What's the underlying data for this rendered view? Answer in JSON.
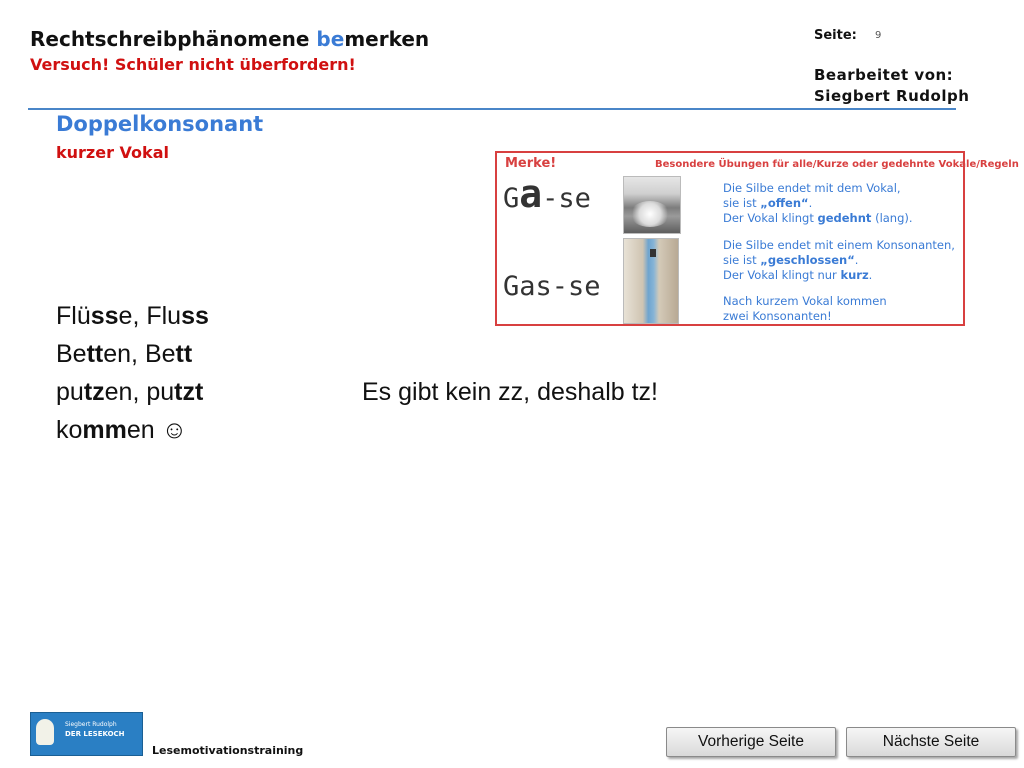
{
  "header": {
    "title_part1": "Rechtschreibphänomene ",
    "title_highlight": "be",
    "title_part2": "merken",
    "subtitle": "Versuch! Schüler nicht überfordern!",
    "page_label": "Seite:",
    "page_number": "9",
    "edited_by_label": "Bearbeitet von:",
    "edited_by_name": "Siegbert Rudolph"
  },
  "section": {
    "title": "Doppelkonsonant",
    "subtitle": "kurzer Vokal"
  },
  "merke": {
    "title": "Merke!",
    "heading": "Besondere Übungen für alle/Kurze oder gedehnte Vokale/Regeln",
    "word1_prefix": "G",
    "word1_vowel": "a",
    "word1_suffix": "-se",
    "word2": "Gas-se",
    "info1_line1": "Die Silbe endet mit dem Vokal,",
    "info1_line2_pre": "sie ist ",
    "info1_line2_bold": "„offen“",
    "info1_line2_post": ".",
    "info1_line3_pre": "Der Vokal klingt ",
    "info1_line3_bold": "gedehnt",
    "info1_line3_post": " (lang).",
    "info2_line1": "Die Silbe endet mit einem Konsonanten,",
    "info2_line2_pre": "sie ist ",
    "info2_line2_bold": "„geschlossen“",
    "info2_line2_post": ".",
    "info2_line3_pre": "Der Vokal klingt nur ",
    "info2_line3_bold": "kurz",
    "info2_line3_post": ".",
    "info3_line1": "Nach kurzem Vokal kommen",
    "info3_line2": "zwei Konsonanten!"
  },
  "examples": {
    "row1": {
      "a": "Flü",
      "b": "ss",
      "c": "e, Flu",
      "d": "ss"
    },
    "row2": {
      "a": "Be",
      "b": "tt",
      "c": "en, Be",
      "d": "tt"
    },
    "row3": {
      "a": "pu",
      "b": "tz",
      "c": "en, pu",
      "d": "tzt"
    },
    "row4": {
      "a": "ko",
      "b": "mm",
      "c": "en ",
      "smiley": "☺"
    },
    "note": "Es gibt kein zz, deshalb tz!"
  },
  "footer": {
    "logo_line1": "Siegbert Rudolph",
    "logo_line2": "DER LESEKOCH",
    "label": "Lesemotivationstraining",
    "prev_button": "Vorherige Seite",
    "next_button": "Nächste Seite"
  }
}
